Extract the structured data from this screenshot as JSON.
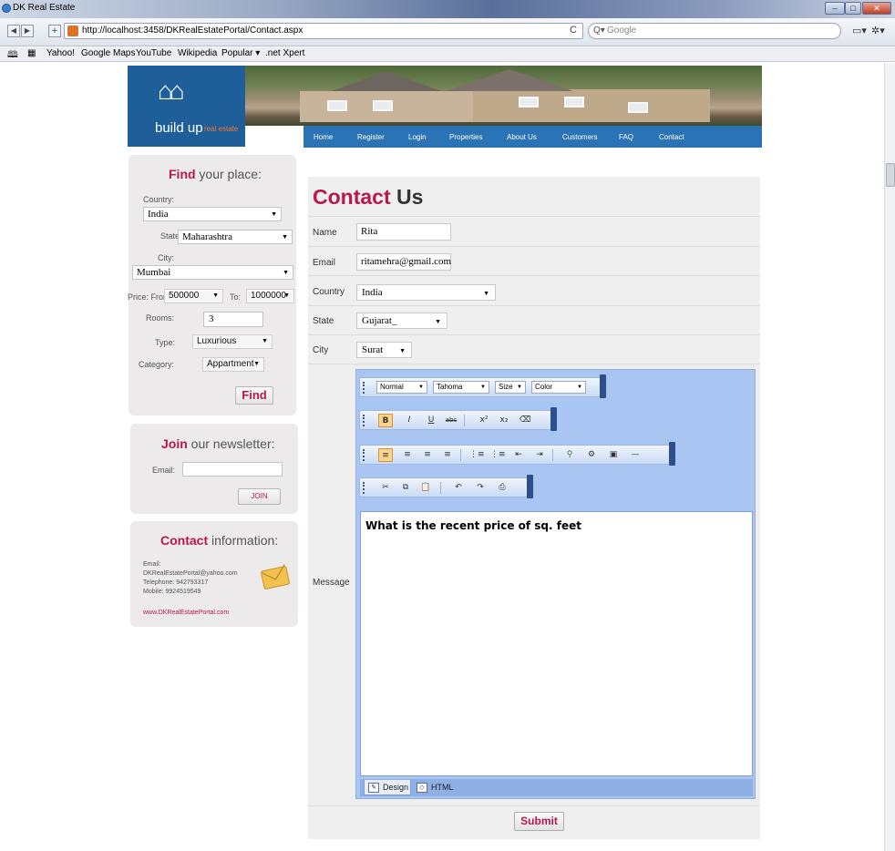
{
  "browser": {
    "window_title": "DK Real Estate",
    "url": "http://localhost:3458/DKRealEstatePortal/Contact.aspx",
    "search_placeholder": "Google",
    "search_glyph": "Q▾",
    "reload_glyph": "C",
    "bookmarks": [
      "Yahoo!",
      "Google Maps",
      "YouTube",
      "Wikipedia",
      "Popular ▾",
      ".net Xpert"
    ]
  },
  "header": {
    "logo_text": "build up",
    "logo_sub": "real estate",
    "menu": [
      "Home",
      "Register",
      "Login",
      "Properties",
      "About Us",
      "Customers",
      "FAQ",
      "Contact"
    ]
  },
  "find_panel": {
    "title_highlight": "Find",
    "title_rest": " your place:",
    "country_label": "Country:",
    "country_value": "India",
    "state_label": "State:",
    "state_value": "Maharashtra",
    "city_label": "City:",
    "city_value": "Mumbai",
    "price_label": "Price: From:",
    "price_from": "500000",
    "to_label": "To:",
    "price_to": "1000000",
    "rooms_label": "Rooms:",
    "rooms_value": "3",
    "type_label": "Type:",
    "type_value": "Luxurious",
    "category_label": "Category:",
    "category_value": "Appartment",
    "button": "Find"
  },
  "newsletter": {
    "title_highlight": "Join",
    "title_rest": " our newsletter:",
    "email_label": "Email:",
    "email_value": "",
    "button": "JOIN"
  },
  "contact_info": {
    "title_highlight": "Contact",
    "title_rest": " information:",
    "email_label": "Email:",
    "email": "DKRealEstatePortal@yahoo.com",
    "telephone": "Telephone: 942793317",
    "mobile": "Mobile: 9924519549",
    "website": "www.DKRealEstatePortal.com"
  },
  "contact_form": {
    "title_highlight": "Contact",
    "title_rest": " Us",
    "name_label": "Name",
    "name_value": "Rita",
    "email_label": "Email",
    "email_value": "ritamehra@gmail.com",
    "country_label": "Country",
    "country_value": "India",
    "state_label": "State",
    "state_value": "Gujarat_",
    "city_label": "City",
    "city_value": "Surat",
    "message_label": "Message",
    "submit": "Submit"
  },
  "editor": {
    "format_value": "Normal",
    "font_value": "Tahoma",
    "size_value": "Size",
    "color_value": "Color",
    "content": "What is the recent price of sq. feet",
    "design_tab": "Design",
    "html_tab": "HTML"
  },
  "colors": {
    "accent": "#b8174f",
    "header_blue": "#1e5f9a",
    "menu_blue": "#2a73b4",
    "editor_blue": "#a9c6f2"
  }
}
